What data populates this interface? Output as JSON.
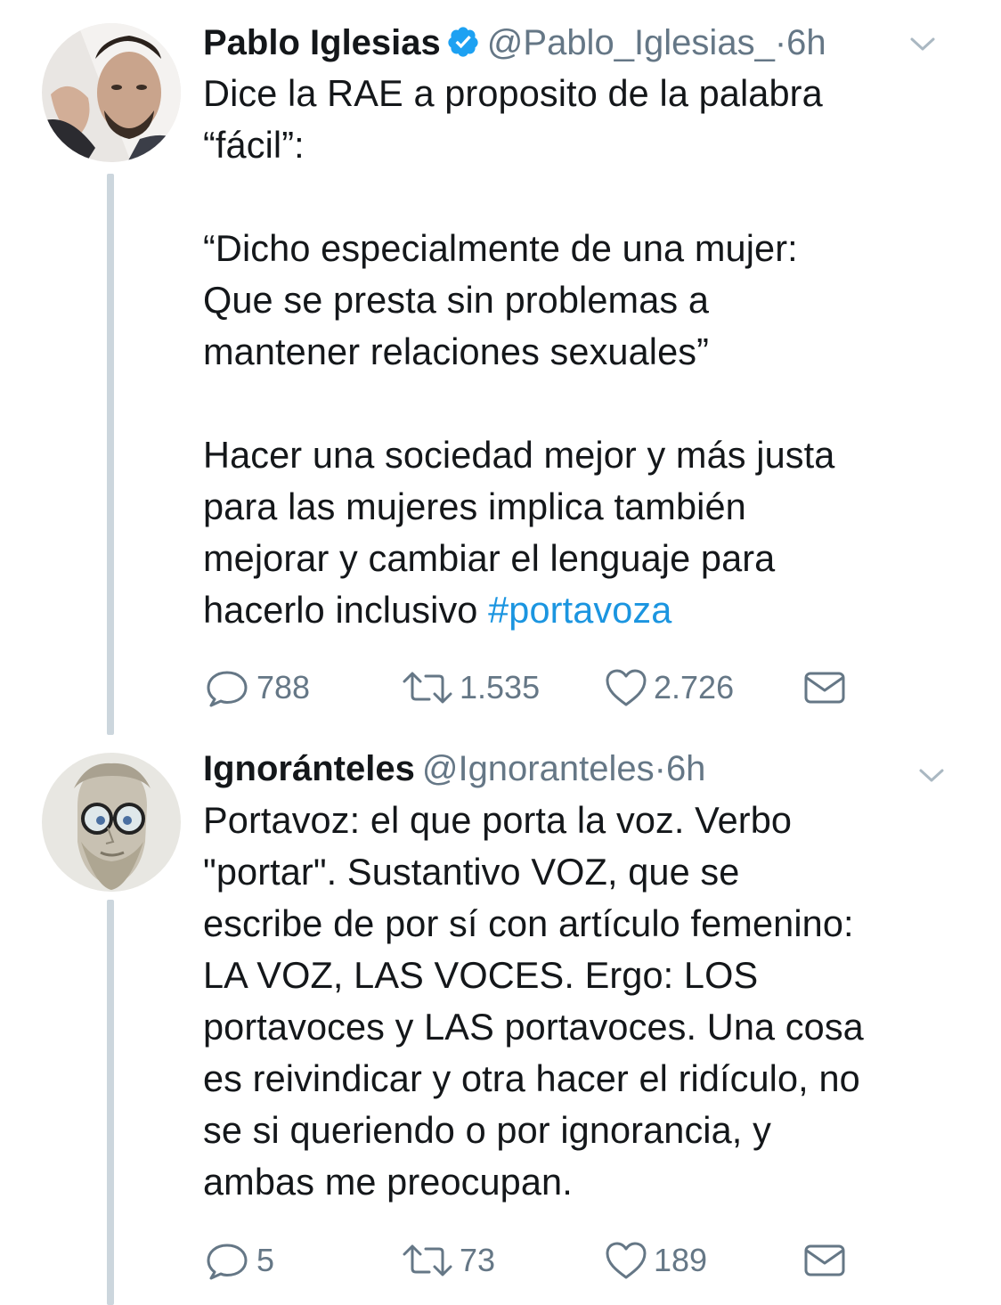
{
  "tweets": [
    {
      "author_name": "Pablo Iglesias",
      "verified": true,
      "handle": "@Pablo_Iglesias_",
      "separator": "·",
      "time": "6h",
      "text_part": "Dice la RAE a proposito de la palabra\n“fácil”:\n\n“Dicho especialmente de una mujer:\nQue se presta sin problemas a\nmantener relaciones sexuales”\n\nHacer una sociedad mejor y más justa\npara las mujeres implica también\nmejorar y cambiar el lenguaje para\nhacerlo inclusivo ",
      "hashtag": "#portavoza",
      "replies": "788",
      "retweets": "1.535",
      "likes": "2.726"
    },
    {
      "author_name": "Ignoránteles",
      "verified": false,
      "handle": "@Ignoranteles",
      "separator": "·",
      "time": "6h",
      "text_part": "Portavoz: el que porta la voz. Verbo\n\"portar\". Sustantivo VOZ, que se\nescribe de por sí con artículo femenino:\nLA VOZ, LAS VOCES. Ergo: LOS\nportavoces y LAS portavoces. Una cosa\nes reivindicar y otra hacer el ridículo, no\nse si queriendo o por ignorancia, y\nambas me preocupan.",
      "replies": "5",
      "retweets": "73",
      "likes": "189"
    }
  ],
  "icons": {
    "reply": "speech-bubble-icon",
    "retweet": "retweet-arrows-icon",
    "like": "heart-icon",
    "dm": "envelope-icon",
    "caret": "chevron-down-icon",
    "verified": "verified-badge-icon"
  },
  "colors": {
    "text": "#14171a",
    "secondary": "#657786",
    "link": "#1b95e0",
    "verified": "#1da1f2",
    "thread_line": "#ccd6dd"
  }
}
